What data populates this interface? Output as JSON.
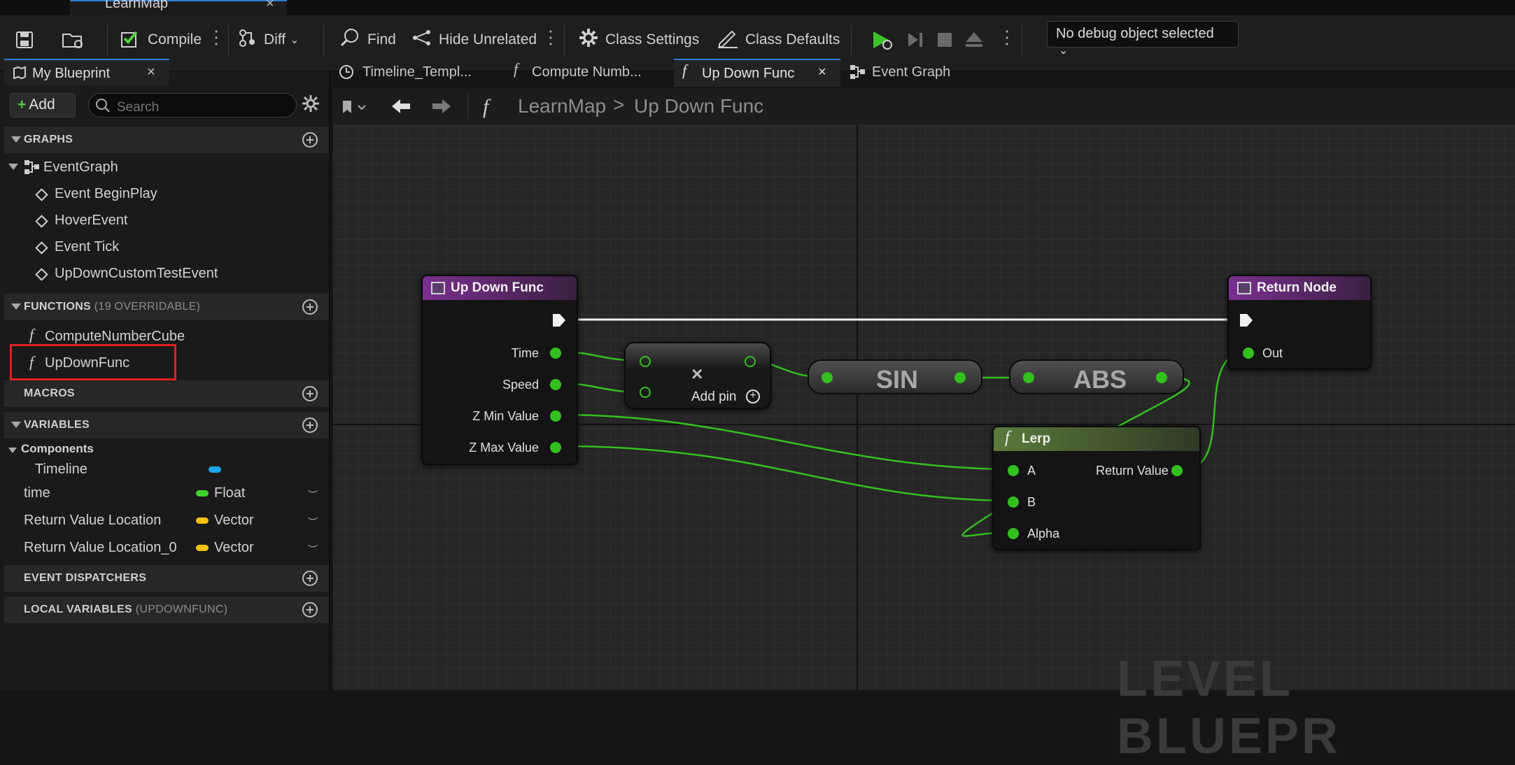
{
  "window": {
    "tab_title": "LearnMap",
    "close": "×"
  },
  "toolbar": {
    "compile": "Compile",
    "diff": "Diff",
    "find": "Find",
    "hide_unrelated": "Hide Unrelated",
    "class_settings": "Class Settings",
    "class_defaults": "Class Defaults",
    "debug_object": "No debug object selected"
  },
  "left_panel": {
    "tab_label": "My Blueprint",
    "tab_close": "×",
    "add_label": "Add",
    "search_placeholder": "Search",
    "graphs": {
      "label": "GRAPHS",
      "root": "EventGraph",
      "events": [
        "Event BeginPlay",
        "HoverEvent",
        "Event Tick",
        "UpDownCustomTestEvent"
      ]
    },
    "functions": {
      "label": "FUNCTIONS",
      "count": "(19 OVERRIDABLE)",
      "items": [
        "ComputeNumberCube",
        "UpDownFunc"
      ],
      "selected": "UpDownFunc"
    },
    "macros": {
      "label": "MACROS"
    },
    "variables": {
      "label": "VARIABLES",
      "category": "Components",
      "items": [
        {
          "name": "Timeline",
          "type": "",
          "color": "#1aa5ea"
        },
        {
          "name": "time",
          "type": "Float",
          "color": "#3bd12a"
        },
        {
          "name": "Return Value Location",
          "type": "Vector",
          "color": "#f4c20d"
        },
        {
          "name": "Return Value Location_0",
          "type": "Vector",
          "color": "#f4c20d"
        }
      ]
    },
    "event_dispatchers": {
      "label": "EVENT DISPATCHERS"
    },
    "local_variables": {
      "label": "LOCAL VARIABLES",
      "scope": "(UPDOWNFUNC)"
    }
  },
  "doc_tabs": [
    {
      "label": "Timeline_Templ...",
      "active": false
    },
    {
      "label": "Compute Numb...",
      "active": false
    },
    {
      "label": "Up Down Func",
      "active": true
    },
    {
      "label": "Event Graph",
      "active": false
    }
  ],
  "breadcrumb": {
    "root": "LearnMap",
    "current": "Up Down Func",
    "sep": ">"
  },
  "graph": {
    "watermark": "LEVEL BLUEPR",
    "entry_node": {
      "title": "Up Down Func",
      "pins": [
        "Time",
        "Speed",
        "Z Min Value",
        "Z Max Value"
      ]
    },
    "multiply_node": {
      "add_pin": "Add pin",
      "op": "×"
    },
    "sin_node": {
      "label": "SIN"
    },
    "abs_node": {
      "label": "ABS"
    },
    "lerp_node": {
      "title": "Lerp",
      "inputs": [
        "A",
        "B",
        "Alpha"
      ],
      "output": "Return Value"
    },
    "return_node": {
      "title": "Return Node",
      "pins": [
        "Out"
      ]
    }
  }
}
